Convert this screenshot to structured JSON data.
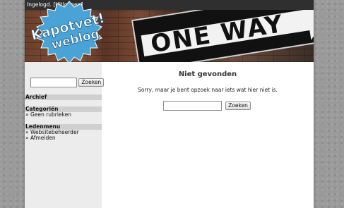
{
  "topbar": {
    "logged_in": "Ingelogd.",
    "logout": "[Uitloggen]"
  },
  "header": {
    "logo_line1": "Kapotvet!",
    "logo_line2": "weblog",
    "sign_text": "ONE WAY"
  },
  "sidebar": {
    "search": {
      "value": "",
      "button": "Zoeken"
    },
    "archive_title": "Archief",
    "categories_title": "Categoriën",
    "categories": [
      "» Geen rubrieken"
    ],
    "members_title": "Ledenmenu",
    "members": [
      "» Websitebeheerder",
      "» Afmelden"
    ]
  },
  "main": {
    "title": "Niet gevonden",
    "message": "Sorry, maar je bent opzoek naar iets wat hier niet is.",
    "search": {
      "value": "",
      "button": "Zoeken"
    }
  },
  "colors": {
    "page_bg": "#9a9a9a",
    "topbar": "#2f2f2f",
    "sidebar": "#ececec",
    "sidebar_heading": "#cfcfcf",
    "logo_badge": "#4aa3d6"
  }
}
